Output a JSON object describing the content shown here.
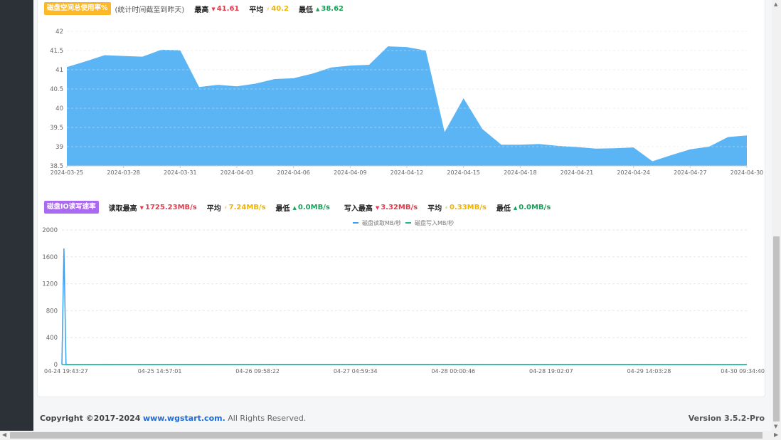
{
  "disk_usage": {
    "tag": "磁盘空间总使用率%",
    "note": "(统计时间截至到昨天)",
    "max_label": "最高",
    "max_value": "41.61",
    "avg_label": "平均",
    "avg_value": "40.2",
    "min_label": "最低",
    "min_value": "38.62"
  },
  "disk_io": {
    "tag": "磁盘IO读写速率",
    "read_max_label": "读取最高",
    "read_max_value": "1725.23MB/s",
    "read_avg_label": "平均",
    "read_avg_value": "7.24MB/s",
    "read_min_label": "最低",
    "read_min_value": "0.0MB/s",
    "write_max_label": "写入最高",
    "write_max_value": "3.32MB/s",
    "write_avg_label": "平均",
    "write_avg_value": "0.33MB/s",
    "write_min_label": "最低",
    "write_min_value": "0.0MB/s"
  },
  "chart_data": [
    {
      "type": "area",
      "title": "",
      "ylim": [
        38.5,
        42
      ],
      "yticks": [
        "42",
        "41.5",
        "41",
        "40.5",
        "40",
        "39.5",
        "39",
        "38.5"
      ],
      "xticks": [
        "2024-03-25",
        "2024-03-28",
        "2024-03-31",
        "2024-04-03",
        "2024-04-06",
        "2024-04-09",
        "2024-04-12",
        "2024-04-15",
        "2024-04-18",
        "2024-04-21",
        "2024-04-24",
        "2024-04-27",
        "2024-04-30"
      ],
      "x": [
        "2024-03-25",
        "2024-03-26",
        "2024-03-27",
        "2024-03-28",
        "2024-03-29",
        "2024-03-30",
        "2024-03-31",
        "2024-04-01",
        "2024-04-02",
        "2024-04-03",
        "2024-04-04",
        "2024-04-05",
        "2024-04-06",
        "2024-04-07",
        "2024-04-08",
        "2024-04-09",
        "2024-04-10",
        "2024-04-11",
        "2024-04-12",
        "2024-04-13",
        "2024-04-14",
        "2024-04-15",
        "2024-04-16",
        "2024-04-17",
        "2024-04-18",
        "2024-04-19",
        "2024-04-20",
        "2024-04-21",
        "2024-04-22",
        "2024-04-23",
        "2024-04-24",
        "2024-04-25",
        "2024-04-26",
        "2024-04-27",
        "2024-04-28",
        "2024-04-29",
        "2024-04-30"
      ],
      "values": [
        41.07,
        41.22,
        41.38,
        41.36,
        41.34,
        41.52,
        41.51,
        40.55,
        40.61,
        40.57,
        40.64,
        40.76,
        40.78,
        40.9,
        41.06,
        41.11,
        41.13,
        41.61,
        41.59,
        41.5,
        39.38,
        40.26,
        39.46,
        39.05,
        39.05,
        39.07,
        39.02,
        38.99,
        38.95,
        38.96,
        38.98,
        38.62,
        38.78,
        38.93,
        39.0,
        39.25,
        39.29
      ],
      "color": "#5bb5f5",
      "grid": true
    },
    {
      "type": "line",
      "title": "",
      "legend": "top-center",
      "ylim": [
        0,
        2000
      ],
      "yticks": [
        "2000",
        "1600",
        "1200",
        "800",
        "400",
        "0"
      ],
      "xticks": [
        "04-24 19:43:27",
        "04-25 14:57:01",
        "04-26 09:58:22",
        "04-27 04:59:34",
        "04-28 00:00:46",
        "04-28 19:02:07",
        "04-29 14:03:28",
        "04-30 09:34:40"
      ],
      "series": [
        {
          "name": "磁盘读取MB/秒",
          "color": "#3a9ff5",
          "points": [
            [
              0,
              0
            ],
            [
              0.003,
              1725.23
            ],
            [
              0.006,
              0
            ],
            [
              1,
              0
            ]
          ]
        },
        {
          "name": "磁盘写入MB/秒",
          "color": "#1aba8a",
          "points": [
            [
              0,
              0
            ],
            [
              0.373,
              3.32
            ],
            [
              1,
              0
            ]
          ]
        }
      ],
      "grid": true
    }
  ],
  "footer": {
    "copyright": "Copyright ©2017-2024",
    "site": "www.wgstart.com.",
    "rights": "All Rights Reserved.",
    "version": "Version 3.5.2-Pro"
  }
}
